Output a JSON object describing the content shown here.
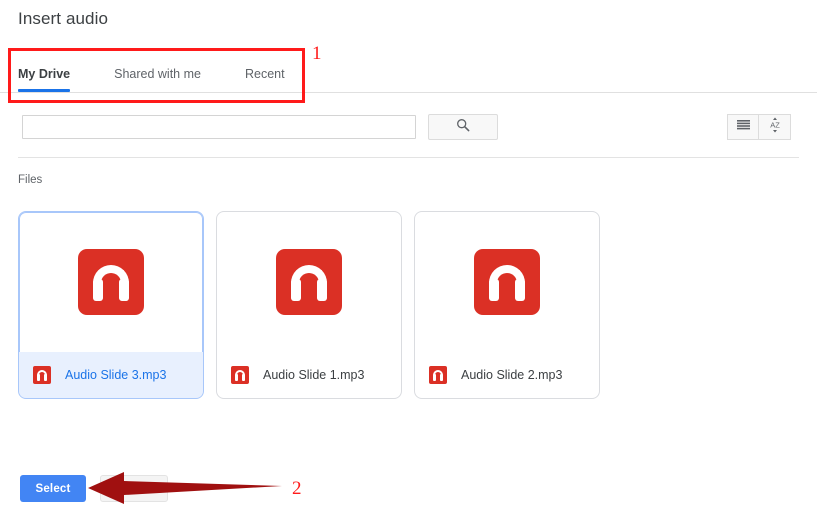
{
  "dialog": {
    "title": "Insert audio"
  },
  "tabs": [
    {
      "label": "My Drive",
      "active": true
    },
    {
      "label": "Shared with me",
      "active": false
    },
    {
      "label": "Recent",
      "active": false
    }
  ],
  "search": {
    "value": "",
    "placeholder": "",
    "button_icon": "search-icon"
  },
  "toolbar": {
    "view_list_icon": "list-view-icon",
    "sort_az_icon": "sort-az-icon"
  },
  "section": {
    "label": "Files"
  },
  "files": [
    {
      "name": "Audio Slide 3.mp3",
      "selected": true,
      "icon": "audio-file-icon"
    },
    {
      "name": "Audio Slide 1.mp3",
      "selected": false,
      "icon": "audio-file-icon"
    },
    {
      "name": "Audio Slide 2.mp3",
      "selected": false,
      "icon": "audio-file-icon"
    }
  ],
  "footer": {
    "select_label": "Select",
    "cancel_label": "Cancel"
  },
  "annotations": [
    {
      "id": "1",
      "kind": "box",
      "target": "tab-bar"
    },
    {
      "id": "2",
      "kind": "arrow",
      "target": "select-button"
    }
  ],
  "colors": {
    "accent_blue": "#4285f4",
    "tab_underline": "#1a73e8",
    "selected_fill": "#e8f0fe",
    "selected_border": "#a8c7fa",
    "audio_red": "#db3025",
    "annotation_red": "#ff1a1a",
    "arrow_red": "#a01010"
  }
}
